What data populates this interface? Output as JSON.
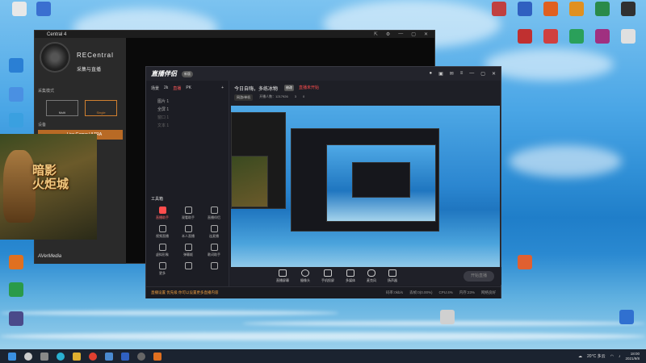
{
  "desktop": {
    "icons_left": [
      {
        "label": "",
        "color": "#e8e8e8"
      },
      {
        "label": "",
        "color": "#3a6fd0"
      },
      {
        "label": "",
        "color": "#2a7fd4"
      },
      {
        "label": "",
        "color": "#4a90e2"
      },
      {
        "label": "",
        "color": "#3aa0e0"
      },
      {
        "label": "",
        "color": "#e0a020"
      }
    ],
    "icons_right": [
      {
        "label": "",
        "color": "#c04040"
      },
      {
        "label": "",
        "color": "#3060c0"
      },
      {
        "label": "",
        "color": "#e06020"
      },
      {
        "label": "",
        "color": "#2a8a4a"
      },
      {
        "label": "",
        "color": "#4080d0"
      },
      {
        "label": "",
        "color": "#303030"
      }
    ]
  },
  "recentral": {
    "title": "Central 4",
    "brand": "RECentral",
    "subtitle": "采集与直播",
    "modes": [
      "Multi",
      "Single"
    ],
    "device": "Live Gamer ULTRA",
    "footer_logo": "AVerMedia"
  },
  "game_art": {
    "title": "暗影\n火炬城"
  },
  "live": {
    "logo": "直播伴侣",
    "badge": "新版",
    "scene_tabs": [
      "场景",
      "2k",
      "直播",
      "PK"
    ],
    "sources": [
      "图片 1",
      "全屏 1",
      "窗口 1",
      "文本 1"
    ],
    "tools_title": "工具箱",
    "tools": [
      {
        "label": "直播助手",
        "red": true
      },
      {
        "label": "观看助手",
        "red": false
      },
      {
        "label": "直播伴侣",
        "red": false
      },
      {
        "label": "视频直播",
        "red": false
      },
      {
        "label": "本人直播",
        "red": false
      },
      {
        "label": "连麦播",
        "red": false
      },
      {
        "label": "虚拟形象",
        "red": false
      },
      {
        "label": "弹幕姬",
        "red": false
      },
      {
        "label": "歌词助手",
        "red": false
      },
      {
        "label": "更多",
        "red": false
      },
      {
        "label": "",
        "red": false
      },
      {
        "label": "",
        "red": false
      }
    ],
    "stream_title": "今日自嗨，多练冰物",
    "stream_edit": "修改",
    "stream_warning": "直播未开始",
    "stream_tag": "网游/单机",
    "stream_meta": [
      "开播人数：1217926",
      "3",
      "0"
    ],
    "bottom_buttons": [
      "直播屏幕",
      "摄像头",
      "手机投屏",
      "多媒体",
      "麦克风",
      "扬声器"
    ],
    "start_label": "开始直播",
    "status_text": "直播设置 优先级 你可以设置更多直播内容",
    "status_stats": [
      "码率:0kb/s",
      "丢帧:0(0.00%)",
      "CPU:4%",
      "内存:23%",
      "网络良好"
    ]
  },
  "taskbar": {
    "weather": "20°C 多云",
    "time": "18:00",
    "date": "2021/9/8"
  }
}
